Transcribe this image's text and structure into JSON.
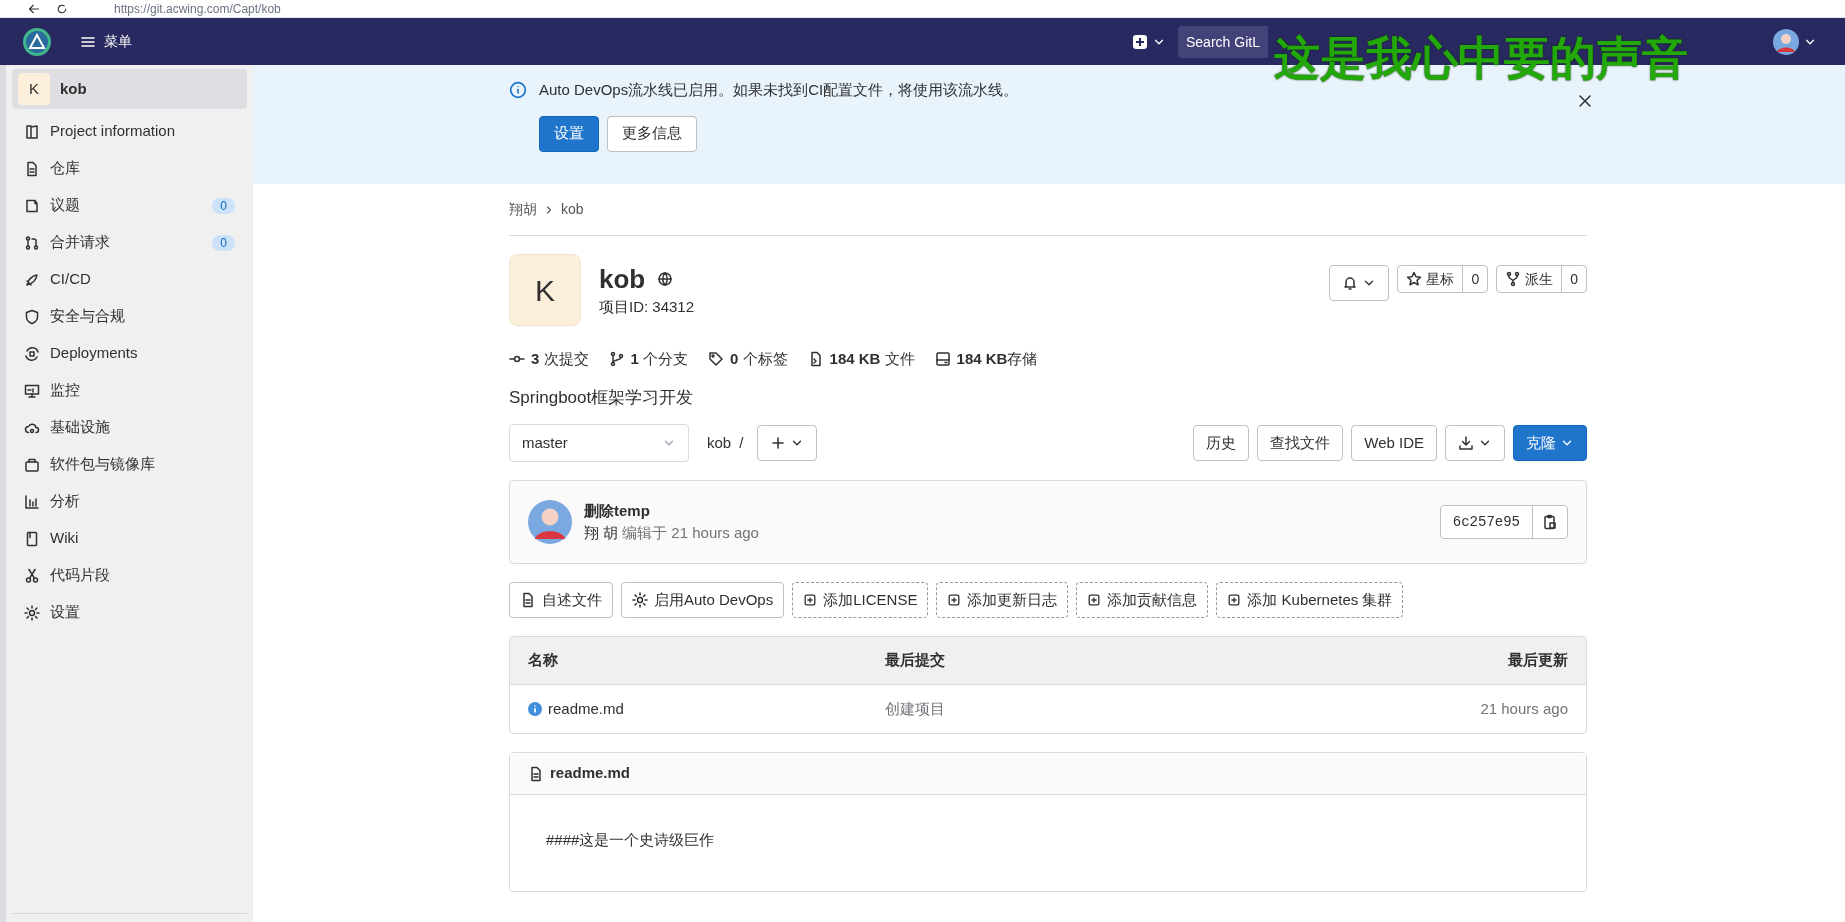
{
  "browser": {
    "url": "https://git.acwing.com/Capt/kob"
  },
  "navbar": {
    "menu_label": "菜单",
    "search": {
      "placeholder": "Search GitL"
    }
  },
  "overlay_lyric": "这是我心中要的声音",
  "sidebar": {
    "project": {
      "initial": "K",
      "name": "kob"
    },
    "items": [
      {
        "label": "Project information"
      },
      {
        "label": "仓库"
      },
      {
        "label": "议题",
        "badge": "0"
      },
      {
        "label": "合并请求",
        "badge": "0"
      },
      {
        "label": "CI/CD"
      },
      {
        "label": "安全与合规"
      },
      {
        "label": "Deployments"
      },
      {
        "label": "监控"
      },
      {
        "label": "基础设施"
      },
      {
        "label": "软件包与镜像库"
      },
      {
        "label": "分析"
      },
      {
        "label": "Wiki"
      },
      {
        "label": "代码片段"
      },
      {
        "label": "设置"
      }
    ]
  },
  "alert": {
    "message": "Auto DevOps流水线已启用。如果未找到CI配置文件，将使用该流水线。",
    "buttons": [
      {
        "label": "设置",
        "primary": true
      },
      {
        "label": "更多信息",
        "primary": false
      }
    ]
  },
  "breadcrumbs": [
    "翔胡",
    "kob"
  ],
  "project": {
    "initial": "K",
    "name": "kob",
    "id_text": "项目ID: 34312",
    "star_label": "星标",
    "star_count": "0",
    "fork_label": "派生",
    "fork_count": "0"
  },
  "stats": [
    "**3** 次提交",
    "**1** 个分支",
    "**0** 个标签",
    "**184 KB** 文件",
    "**184 KB**存储"
  ],
  "description": "Springboot框架学习开发",
  "repo_bar": {
    "branch": "master",
    "path": "kob",
    "path_separator": "/",
    "buttons": [
      "历史",
      "查找文件",
      "Web IDE"
    ],
    "clone_label": "克隆"
  },
  "commit": {
    "title": "删除temp",
    "author": "翔 胡",
    "meta": "编辑于 21 hours ago",
    "sha": "6c257e95"
  },
  "quick_actions": [
    {
      "label": "自述文件",
      "kind": "solid"
    },
    {
      "label": "启用Auto DevOps",
      "kind": "solid"
    },
    {
      "label": "添加LICENSE",
      "kind": "dashed"
    },
    {
      "label": "添加更新日志",
      "kind": "dashed"
    },
    {
      "label": "添加贡献信息",
      "kind": "dashed"
    },
    {
      "label": "添加 Kubernetes 集群",
      "kind": "dashed"
    }
  ],
  "files": {
    "columns": [
      "名称",
      "最后提交",
      "最后更新"
    ],
    "rows": [
      {
        "name": "readme.md",
        "commit": "创建项目",
        "updated": "21 hours ago"
      }
    ]
  },
  "readme": {
    "filename": "readme.md",
    "content": "####这是一个史诗级巨作"
  }
}
